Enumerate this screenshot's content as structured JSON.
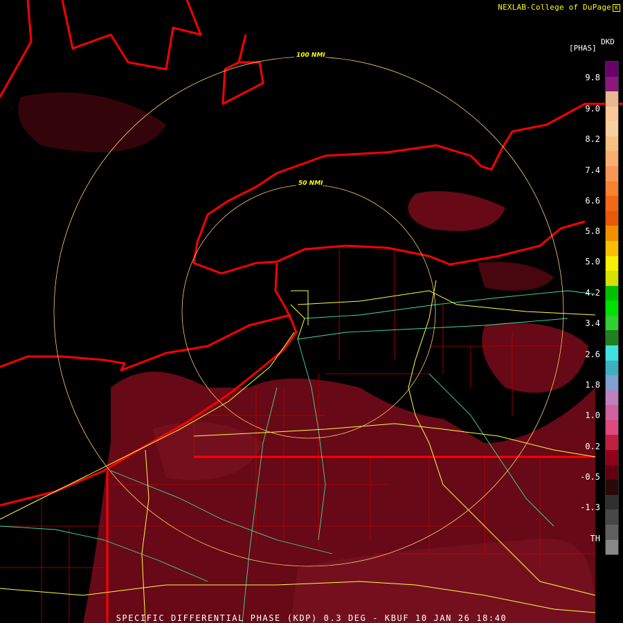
{
  "header": {
    "credit": "NEXLAB-College of DuPage"
  },
  "legend": {
    "product_code": "DKD",
    "unit": "[PHAS]",
    "ticks": [
      "9.8",
      "9.0",
      "8.2",
      "7.4",
      "6.6",
      "5.8",
      "5.0",
      "4.2",
      "3.4",
      "2.6",
      "1.8",
      "1.0",
      "0.2",
      "-0.5",
      "-1.3",
      "TH"
    ],
    "colors": [
      "#6a006a",
      "#8a1a7a",
      "#e8b890",
      "#f8c898",
      "#f8d0a0",
      "#f8c080",
      "#f8b070",
      "#f89858",
      "#f88030",
      "#f06818",
      "#e85808",
      "#f09000",
      "#f8c000",
      "#f8f000",
      "#d8e000",
      "#00c000",
      "#00e000",
      "#30d030",
      "#208020",
      "#40e0e0",
      "#40b0c0",
      "#80a0d0",
      "#c080c0",
      "#d060a0",
      "#e04880",
      "#c02040",
      "#900018",
      "#600010",
      "#2a0808",
      "#303030",
      "#484848",
      "#606060",
      "#888888"
    ],
    "color_names": {
      "border_states": "#ff0000",
      "highways_interstate": "#ffff40",
      "highways_other": "#40e0a0",
      "counties": "#c00000",
      "range_rings": "#ffd070",
      "echo": "#7a0b1a"
    }
  },
  "map": {
    "radar_site": "KBUF",
    "range_rings": [
      {
        "label": "50 NMI"
      },
      {
        "label": "100 NMI"
      }
    ]
  },
  "footer": {
    "title": "SPECIFIC DIFFERENTIAL PHASE (KDP) 0.3 DEG - KBUF 10 JAN 26 18:40"
  }
}
